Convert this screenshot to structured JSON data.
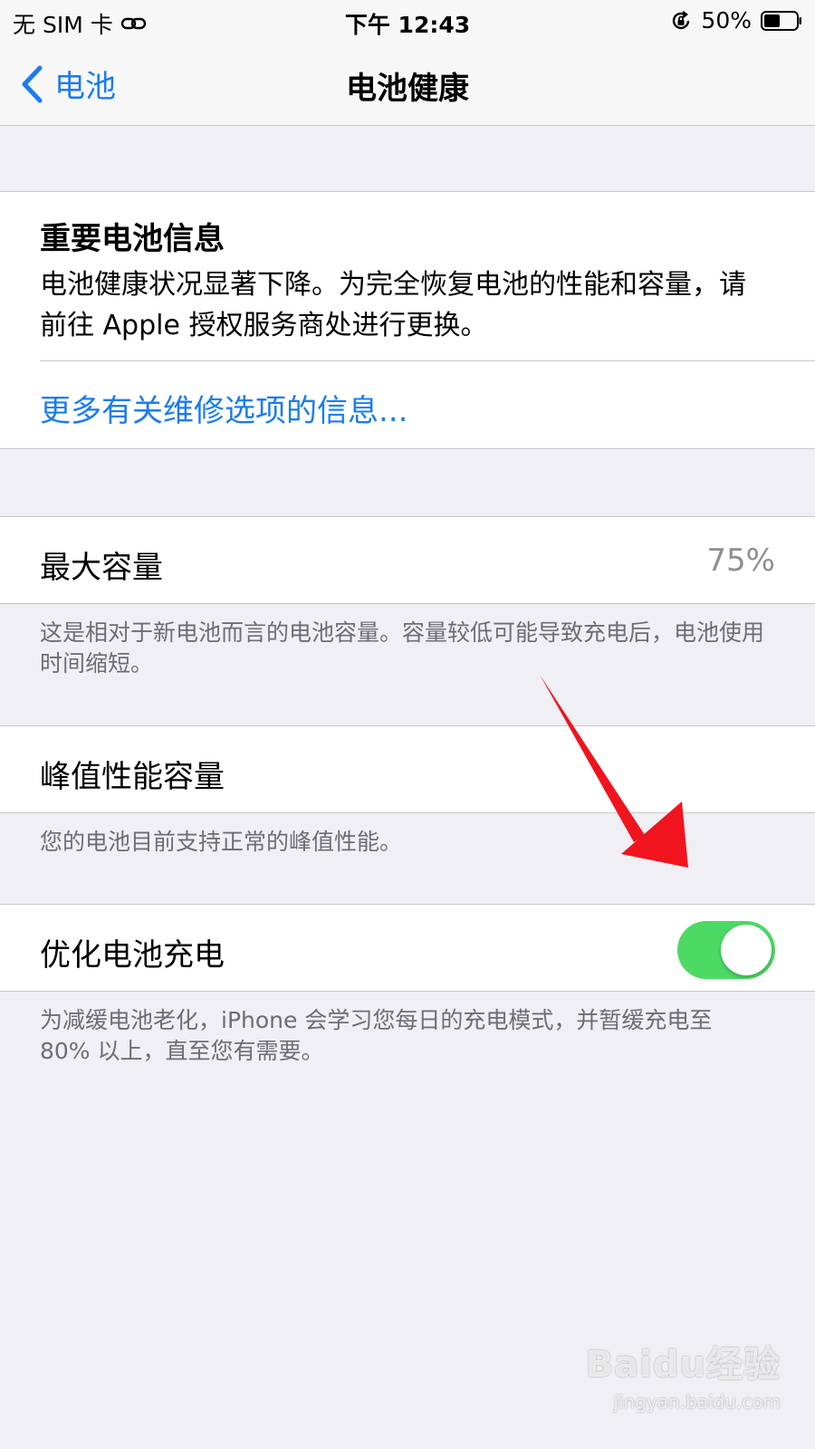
{
  "status_bar": {
    "carrier": "无 SIM 卡",
    "time": "下午 12:43",
    "battery": "50%",
    "icons": [
      "link-icon",
      "orientation-lock-icon",
      "battery-icon"
    ]
  },
  "nav": {
    "back_label": "电池",
    "title": "电池健康"
  },
  "info_card": {
    "title": "重要电池信息",
    "body": "电池健康状况显著下降。为完全恢复电池的性能和容量，请前往 Apple 授权服务商处进行更换。",
    "link": "更多有关维修选项的信息..."
  },
  "max_capacity": {
    "label": "最大容量",
    "value": "75%",
    "footer": "这是相对于新电池而言的电池容量。容量较低可能导致充电后，电池使用时间缩短。"
  },
  "peak_performance": {
    "label": "峰值性能容量",
    "footer": "您的电池目前支持正常的峰值性能。"
  },
  "optimized_charging": {
    "label": "优化电池充电",
    "enabled": true,
    "footer": "为减缓电池老化，iPhone 会学习您每日的充电模式，并暂缓充电至 80% 以上，直至您有需要。"
  },
  "watermark": {
    "brand": "Baidu经验",
    "url": "jingyan.baidu.com"
  },
  "colors": {
    "accent": "#1a7cf0",
    "toggle_on": "#4cd964",
    "annotation_arrow": "#f0141e",
    "background": "#efeff4"
  }
}
